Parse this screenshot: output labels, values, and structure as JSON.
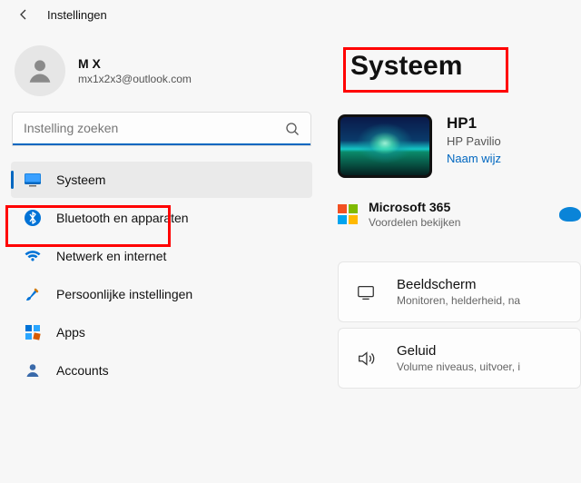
{
  "header": {
    "title": "Instellingen"
  },
  "profile": {
    "name": "M X",
    "email": "mx1x2x3@outlook.com"
  },
  "search": {
    "placeholder": "Instelling zoeken"
  },
  "nav": {
    "items": [
      {
        "label": "Systeem"
      },
      {
        "label": "Bluetooth en apparaten"
      },
      {
        "label": "Netwerk en internet"
      },
      {
        "label": "Persoonlijke instellingen"
      },
      {
        "label": "Apps"
      },
      {
        "label": "Accounts"
      }
    ]
  },
  "main": {
    "title": "Systeem",
    "device": {
      "name": "HP1",
      "model": "HP Pavilio",
      "rename": "Naam wijz"
    },
    "m365": {
      "title": "Microsoft 365",
      "subtitle": "Voordelen bekijken"
    },
    "cards": [
      {
        "title": "Beeldscherm",
        "subtitle": "Monitoren, helderheid, na"
      },
      {
        "title": "Geluid",
        "subtitle": "Volume niveaus, uitvoer, i"
      }
    ]
  }
}
